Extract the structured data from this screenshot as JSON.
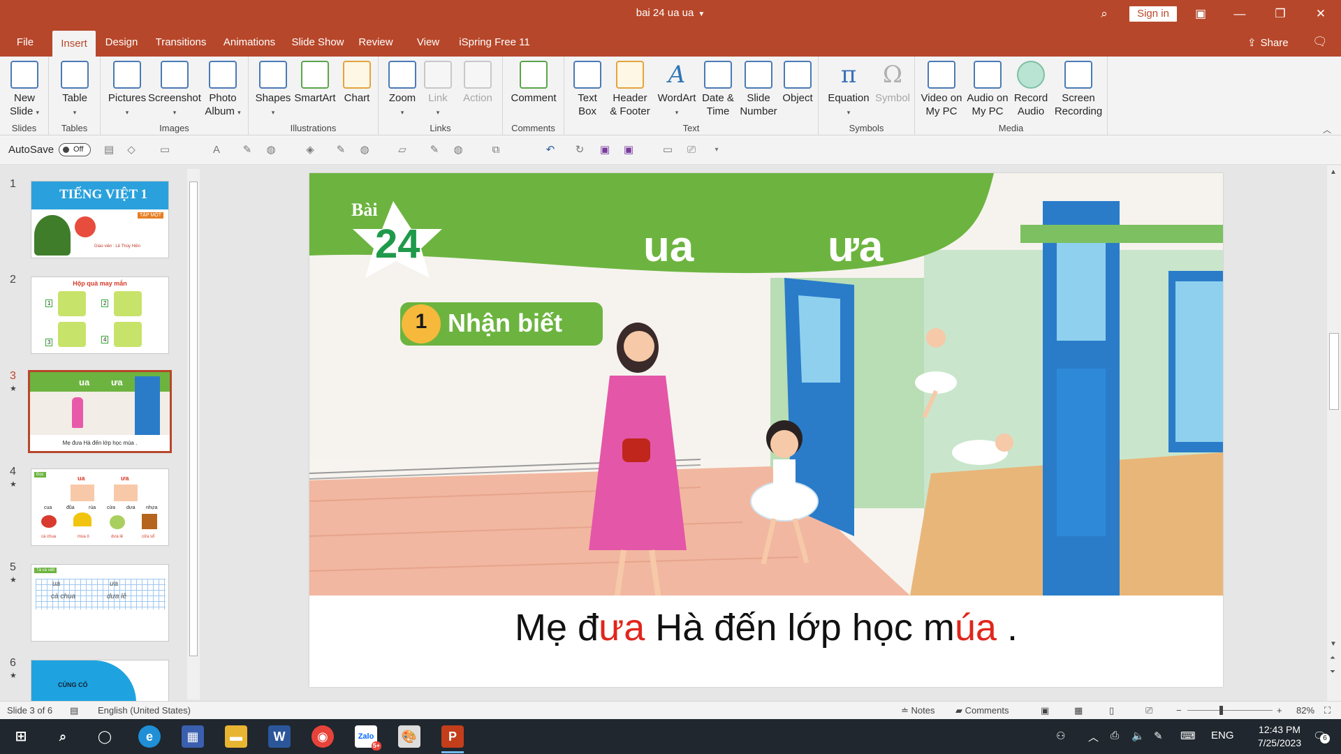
{
  "window": {
    "title": "bai 24 ua ua",
    "sign_in": "Sign in"
  },
  "tabs": [
    "File",
    "Insert",
    "Design",
    "Transitions",
    "Animations",
    "Slide Show",
    "Review",
    "View",
    "iSpring Free 11"
  ],
  "share_label": "Share",
  "ribbon": {
    "groups": {
      "slides": "Slides",
      "tables": "Tables",
      "images": "Images",
      "illustrations": "Illustrations",
      "links": "Links",
      "comments": "Comments",
      "text": "Text",
      "symbols": "Symbols",
      "media": "Media"
    },
    "buttons": {
      "new_slide": [
        "New",
        "Slide"
      ],
      "table": [
        "Table"
      ],
      "pictures": [
        "Pictures"
      ],
      "screenshot": [
        "Screenshot"
      ],
      "photo_album": [
        "Photo",
        "Album"
      ],
      "shapes": [
        "Shapes"
      ],
      "smartart": [
        "SmartArt"
      ],
      "chart": [
        "Chart"
      ],
      "zoom": [
        "Zoom"
      ],
      "link": [
        "Link"
      ],
      "action": [
        "Action"
      ],
      "comment": [
        "Comment"
      ],
      "text_box": [
        "Text",
        "Box"
      ],
      "header_footer": [
        "Header",
        "& Footer"
      ],
      "wordart": [
        "WordArt"
      ],
      "date_time": [
        "Date &",
        "Time"
      ],
      "slide_number": [
        "Slide",
        "Number"
      ],
      "object": [
        "Object"
      ],
      "equation": [
        "Equation"
      ],
      "symbol": [
        "Symbol"
      ],
      "video": [
        "Video on",
        "My PC"
      ],
      "audio": [
        "Audio on",
        "My PC"
      ],
      "record_audio": [
        "Record",
        "Audio"
      ],
      "screen_recording": [
        "Screen",
        "Recording"
      ]
    }
  },
  "qat": {
    "autosave_label": "AutoSave",
    "autosave_state": "Off"
  },
  "thumbnails": [
    {
      "num": "1",
      "star": false,
      "title": "TIẾNG VIỆT 1",
      "badge": "TẬP MỘT",
      "footer": "Giáo viên : Lê Thúy Hiền"
    },
    {
      "num": "2",
      "star": false,
      "title": "Hộp quà may mắn",
      "boxes": [
        "1",
        "2",
        "3",
        "4"
      ]
    },
    {
      "num": "3",
      "star": true,
      "selected": true,
      "words": [
        "ua",
        "ưa"
      ],
      "caption": "Mẹ đưa Hà đến lớp học múa ."
    },
    {
      "num": "4",
      "star": true,
      "label": "Đọc",
      "cols": [
        "ua",
        "ưa"
      ],
      "words": [
        "cua",
        "đũa",
        "rùa",
        "cửa",
        "dưa",
        "nhựa"
      ],
      "items": [
        "cà chua",
        "múa ô",
        "dưa lê",
        "cửa sổ"
      ]
    },
    {
      "num": "5",
      "star": true,
      "label": "Tả và viết",
      "lines": [
        "ua",
        "ưa",
        "cà chua",
        "dưa lê"
      ]
    },
    {
      "num": "6",
      "star": true,
      "title": "CỦNG CỐ"
    }
  ],
  "slide": {
    "lesson_label": "Bài",
    "lesson_number": "24",
    "vowel_1": "ua",
    "vowel_2": "ưa",
    "section_number": "1",
    "section_title": "Nhận biết",
    "caption_parts": [
      {
        "text": "Mẹ đ",
        "red": false
      },
      {
        "text": "ưa",
        "red": true
      },
      {
        "text": " Hà đến lớp học m",
        "red": false
      },
      {
        "text": "úa",
        "red": true
      },
      {
        "text": " .",
        "red": false
      }
    ]
  },
  "status": {
    "slide_info": "Slide 3 of 6",
    "language": "English (United States)",
    "notes": "Notes",
    "comments": "Comments",
    "zoom": "82%"
  },
  "taskbar": {
    "time": "12:43 PM",
    "date": "7/25/2023",
    "lang": "ENG",
    "notifications": "6",
    "zalo_badge": "5+"
  },
  "colors": {
    "accent": "#b7472a",
    "slide_green": "#6cb43f",
    "caption_red": "#e1261c",
    "door_blue": "#2a7cc9"
  }
}
